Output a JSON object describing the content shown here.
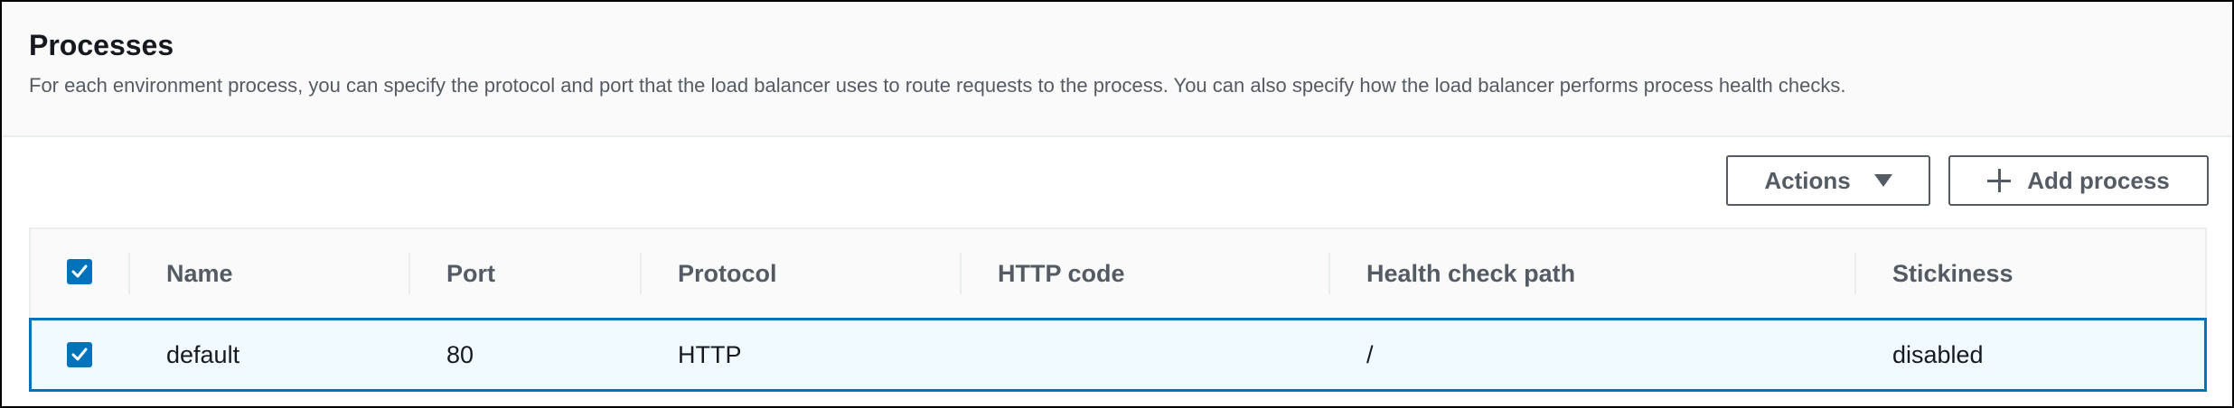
{
  "panel": {
    "title": "Processes",
    "description": "For each environment process, you can specify the protocol and port that the load balancer uses to route requests to the process. You can also specify how the load balancer performs process health checks."
  },
  "toolbar": {
    "actions_label": "Actions",
    "add_process_label": "Add process"
  },
  "table": {
    "columns": [
      "Name",
      "Port",
      "Protocol",
      "HTTP code",
      "Health check path",
      "Stickiness"
    ],
    "select_all_checked": true,
    "rows": [
      {
        "selected": true,
        "name": "default",
        "port": "80",
        "protocol": "HTTP",
        "http_code": "",
        "health_check_path": "/",
        "stickiness": "disabled"
      }
    ]
  },
  "colors": {
    "accent": "#0073bb",
    "selected_row_bg": "#f1faff",
    "header_bg": "#fafafa",
    "secondary_text": "#545b64"
  }
}
